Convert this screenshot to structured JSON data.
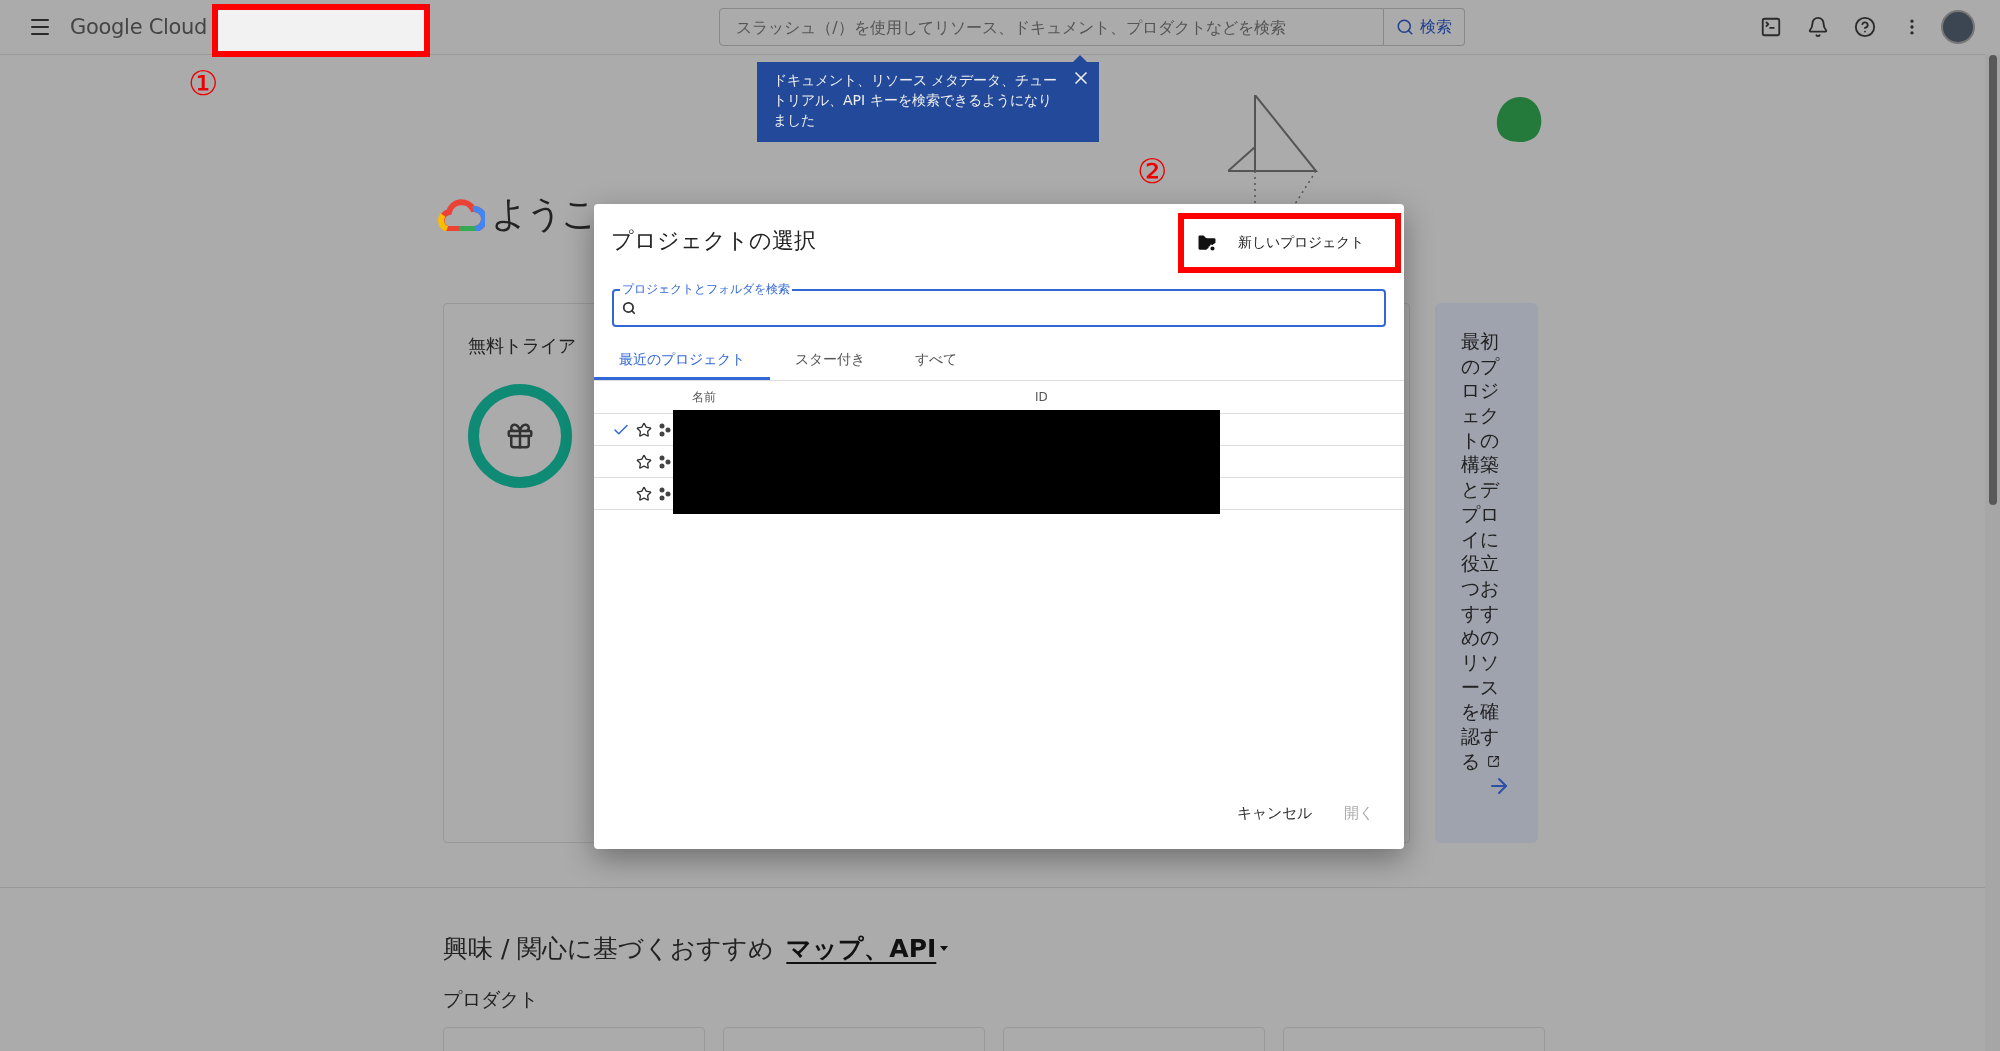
{
  "topbar": {
    "brand": "Google Cloud",
    "search": {
      "placeholder": "スラッシュ（/）を使用してリソース、ドキュメント、プロダクトなどを検索"
    },
    "search_button": "検索"
  },
  "tooltip": {
    "text": "ドキュメント、リソース メタデータ、チュートリアル、API キーを検索できるようになりました"
  },
  "annotations": [
    {
      "label": "①"
    },
    {
      "label": "②"
    }
  ],
  "welcome": {
    "heading": "ようこ"
  },
  "trial_card": {
    "title": "無料トライア"
  },
  "side_panel": {
    "text": "最初のプロジェクトの構築とデプロイに役立つおすすめのリソースを確認する"
  },
  "recommendations": {
    "heading": "興味 / 関心に基づくおすすめ",
    "filter": "マップ、API",
    "subheading": "プロダクト"
  },
  "dialog": {
    "title": "プロジェクトの選択",
    "new_project": "新しいプロジェクト",
    "search": {
      "label": "プロジェクトとフォルダを検索"
    },
    "tabs": [
      {
        "label": "最近のプロジェクト",
        "selected": true
      },
      {
        "label": "スター付き",
        "selected": false
      },
      {
        "label": "すべて",
        "selected": false
      }
    ],
    "columns": [
      "名前",
      "ID"
    ],
    "rows": [
      {
        "current": true,
        "starred": false
      },
      {
        "current": false,
        "starred": false
      },
      {
        "current": false,
        "starred": false
      }
    ],
    "buttons": [
      {
        "label": "キャンセル",
        "disabled": false
      },
      {
        "label": "開く",
        "disabled": true
      }
    ]
  }
}
